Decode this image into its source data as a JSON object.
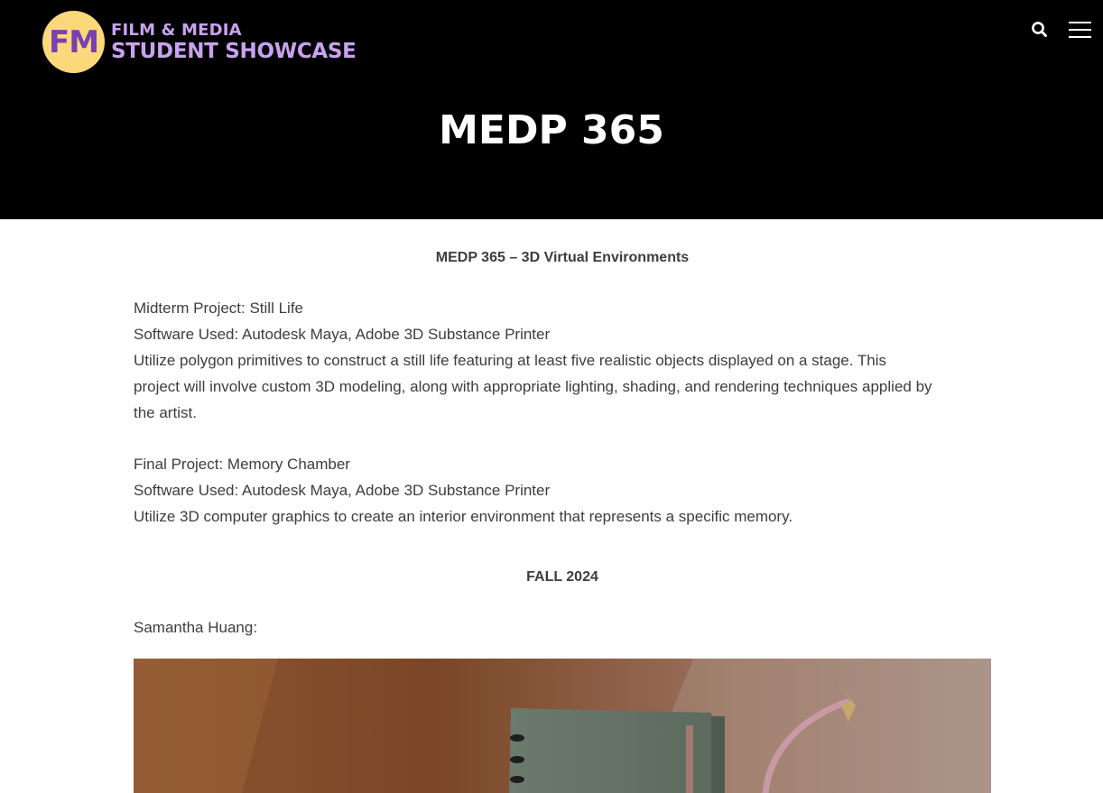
{
  "header": {
    "logo_badge": "FM",
    "logo_line1": "FILM & MEDIA",
    "logo_line2": "STUDENT SHOWCASE",
    "title": "MEDP 365"
  },
  "content": {
    "course_heading": "MEDP 365 – 3D Virtual Environments",
    "midterm": {
      "title": "Midterm Project: Still Life",
      "software": "Software Used: Autodesk Maya, Adobe 3D Substance Printer",
      "description_line1": "Utilize polygon primitives to construct a still life featuring at least five realistic objects displayed on a stage. This",
      "description_line2": "project will involve custom 3D modeling, along with appropriate lighting, shading, and rendering techniques applied by",
      "description_line3": "the artist."
    },
    "final": {
      "title": "Final Project: Memory Chamber",
      "software": "Software Used: Autodesk Maya, Adobe 3D Substance Printer",
      "description": "Utilize 3D computer graphics to create an interior environment that represents a specific memory."
    },
    "term_heading": "FALL 2024",
    "student_name": "Samantha Huang:"
  },
  "icons": {
    "search": "search-icon",
    "menu": "hamburger-menu-icon"
  },
  "colors": {
    "header_bg": "#000000",
    "logo_badge_bg": "#fbd97a",
    "logo_badge_text": "#7a3fb0",
    "logo_text": "#c9a2ef"
  }
}
